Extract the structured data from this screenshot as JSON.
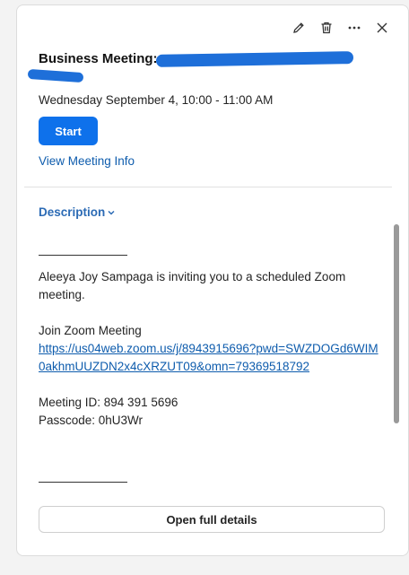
{
  "event": {
    "title": "Business Meeting:",
    "datetime": "Wednesday September 4, 10:00 - 11:00 AM"
  },
  "toolbar": {
    "icons": [
      "pencil-icon",
      "trash-icon",
      "more-icon",
      "close-icon"
    ]
  },
  "actions": {
    "start_label": "Start",
    "view_info_label": "View Meeting Info",
    "open_details_label": "Open full details"
  },
  "description": {
    "toggle_label": "Description",
    "invite_text": "Aleeya Joy Sampaga is inviting you to a scheduled Zoom meeting.",
    "join_label": "Join Zoom Meeting",
    "join_link": "https://us04web.zoom.us/j/8943915696?pwd=SWZDOGd6WIM0akhmUUZDN2x4cXRZUT09&omn=79369518792",
    "meeting_id": "Meeting ID: 894 391 5696",
    "passcode": "Passcode: 0hU3Wr"
  },
  "colors": {
    "accent": "#0e71eb",
    "link": "#0e5cad",
    "redaction": "#1e6fd9"
  }
}
